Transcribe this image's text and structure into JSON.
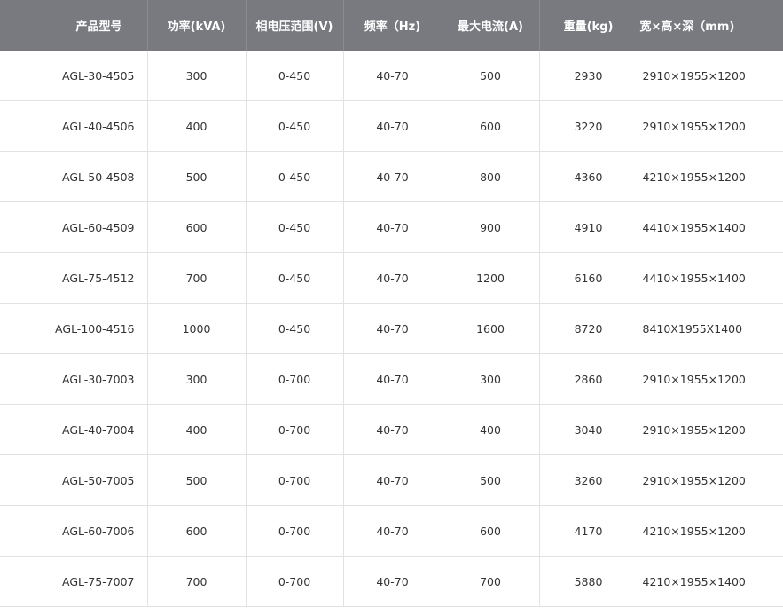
{
  "table": {
    "headers": [
      "产品型号",
      "功率(kVA)",
      "相电压范围(V)",
      "频率（Hz)",
      "最大电流(A)",
      "重量(kg)",
      "宽×高×深（mm)"
    ],
    "rows": [
      [
        "AGL-30-4505",
        "300",
        "0-450",
        "40-70",
        "500",
        "2930",
        "2910×1955×1200"
      ],
      [
        "AGL-40-4506",
        "400",
        "0-450",
        "40-70",
        "600",
        "3220",
        "2910×1955×1200"
      ],
      [
        "AGL-50-4508",
        "500",
        "0-450",
        "40-70",
        "800",
        "4360",
        "4210×1955×1200"
      ],
      [
        "AGL-60-4509",
        "600",
        "0-450",
        "40-70",
        "900",
        "4910",
        "4410×1955×1400"
      ],
      [
        "AGL-75-4512",
        "700",
        "0-450",
        "40-70",
        "1200",
        "6160",
        "4410×1955×1400"
      ],
      [
        "AGL-100-4516",
        "1000",
        "0-450",
        "40-70",
        "1600",
        "8720",
        "8410X1955X1400"
      ],
      [
        "AGL-30-7003",
        "300",
        "0-700",
        "40-70",
        "300",
        "2860",
        "2910×1955×1200"
      ],
      [
        "AGL-40-7004",
        "400",
        "0-700",
        "40-70",
        "400",
        "3040",
        "2910×1955×1200"
      ],
      [
        "AGL-50-7005",
        "500",
        "0-700",
        "40-70",
        "500",
        "3260",
        "2910×1955×1200"
      ],
      [
        "AGL-60-7006",
        "600",
        "0-700",
        "40-70",
        "600",
        "4170",
        "4210×1955×1200"
      ],
      [
        "AGL-75-7007",
        "700",
        "0-700",
        "40-70",
        "700",
        "5880",
        "4210×1955×1400"
      ]
    ]
  },
  "colors": {
    "header_background": "#787a80",
    "header_text": "#ffffff",
    "cell_text": "#333333",
    "grid_line": "#e2e2e2"
  }
}
